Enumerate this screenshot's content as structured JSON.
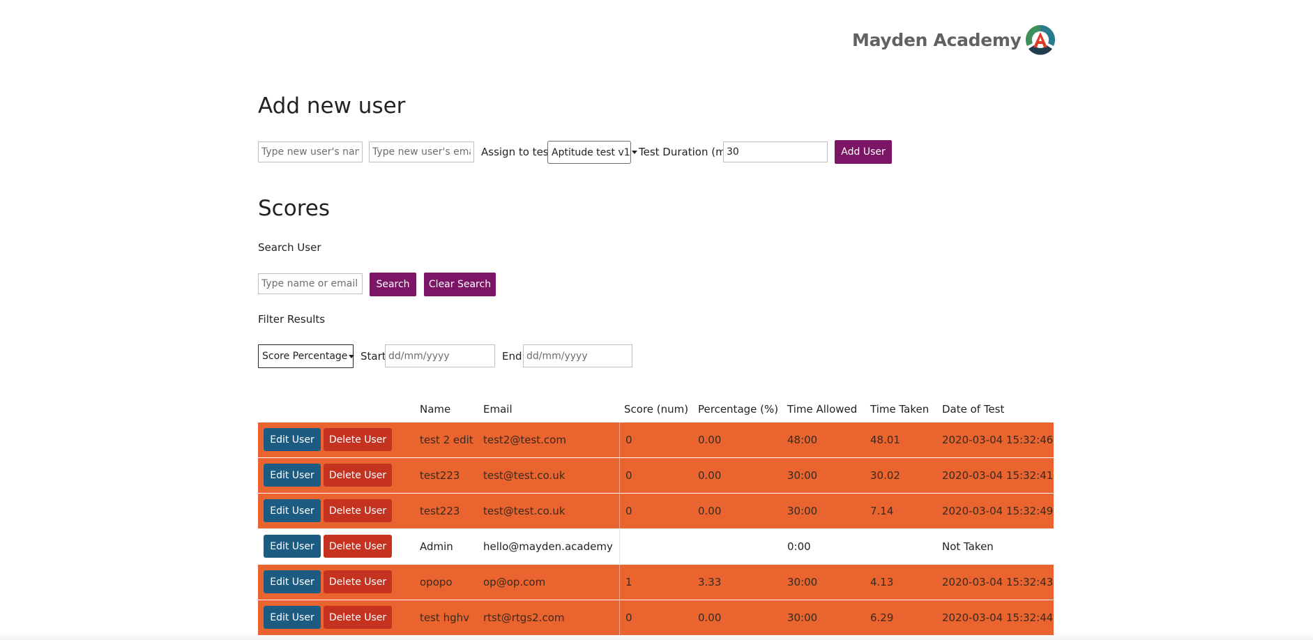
{
  "logo": {
    "text": "Mayden Academy",
    "mark_icon": "mayden-a-logo-icon"
  },
  "add_user": {
    "title": "Add new user",
    "name_placeholder": "Type new user's name",
    "email_placeholder": "Type new user's email",
    "assign_label": "Assign to test:",
    "test_selected": "Aptitude test v1",
    "duration_label": "Test Duration (m):",
    "duration_value": "30",
    "add_button": "Add User"
  },
  "scores": {
    "title": "Scores",
    "search_label": "Search User",
    "search_placeholder": "Type name or email",
    "search_button": "Search",
    "clear_button": "Clear Search",
    "filter_label": "Filter Results",
    "filter_selected": "Score Percentage",
    "start_label": "Start",
    "start_placeholder": "dd/mm/yyyy",
    "end_label": "End",
    "end_placeholder": "dd/mm/yyyy"
  },
  "table": {
    "headers": [
      "Name",
      "Email",
      "Score (num)",
      "Percentage (%)",
      "Time Allowed",
      "Time Taken",
      "Date of Test"
    ],
    "edit_label": "Edit User",
    "delete_label": "Delete User",
    "row_color": "#ea6430",
    "rows": [
      {
        "name": "test 2 edit",
        "email": "test2@test.com",
        "score": "0",
        "percentage": "0.00",
        "allowed": "48:00",
        "taken": "48.01",
        "date": "2020-03-04 15:32:46",
        "highlight": true
      },
      {
        "name": "test223",
        "email": "test@test.co.uk",
        "score": "0",
        "percentage": "0.00",
        "allowed": "30:00",
        "taken": "30.02",
        "date": "2020-03-04 15:32:41",
        "highlight": true
      },
      {
        "name": "test223",
        "email": "test@test.co.uk",
        "score": "0",
        "percentage": "0.00",
        "allowed": "30:00",
        "taken": "7.14",
        "date": "2020-03-04 15:32:49",
        "highlight": true
      },
      {
        "name": "Admin",
        "email": "hello@mayden.academy",
        "score": "",
        "percentage": "",
        "allowed": "0:00",
        "taken": "",
        "date": "Not Taken",
        "highlight": false
      },
      {
        "name": "opopo",
        "email": "op@op.com",
        "score": "1",
        "percentage": "3.33",
        "allowed": "30:00",
        "taken": "4.13",
        "date": "2020-03-04 15:32:43",
        "highlight": true
      },
      {
        "name": "test hghv",
        "email": "rtst@rtgs2.com",
        "score": "0",
        "percentage": "0.00",
        "allowed": "30:00",
        "taken": "6.29",
        "date": "2020-03-04 15:32:44",
        "highlight": true
      }
    ]
  }
}
